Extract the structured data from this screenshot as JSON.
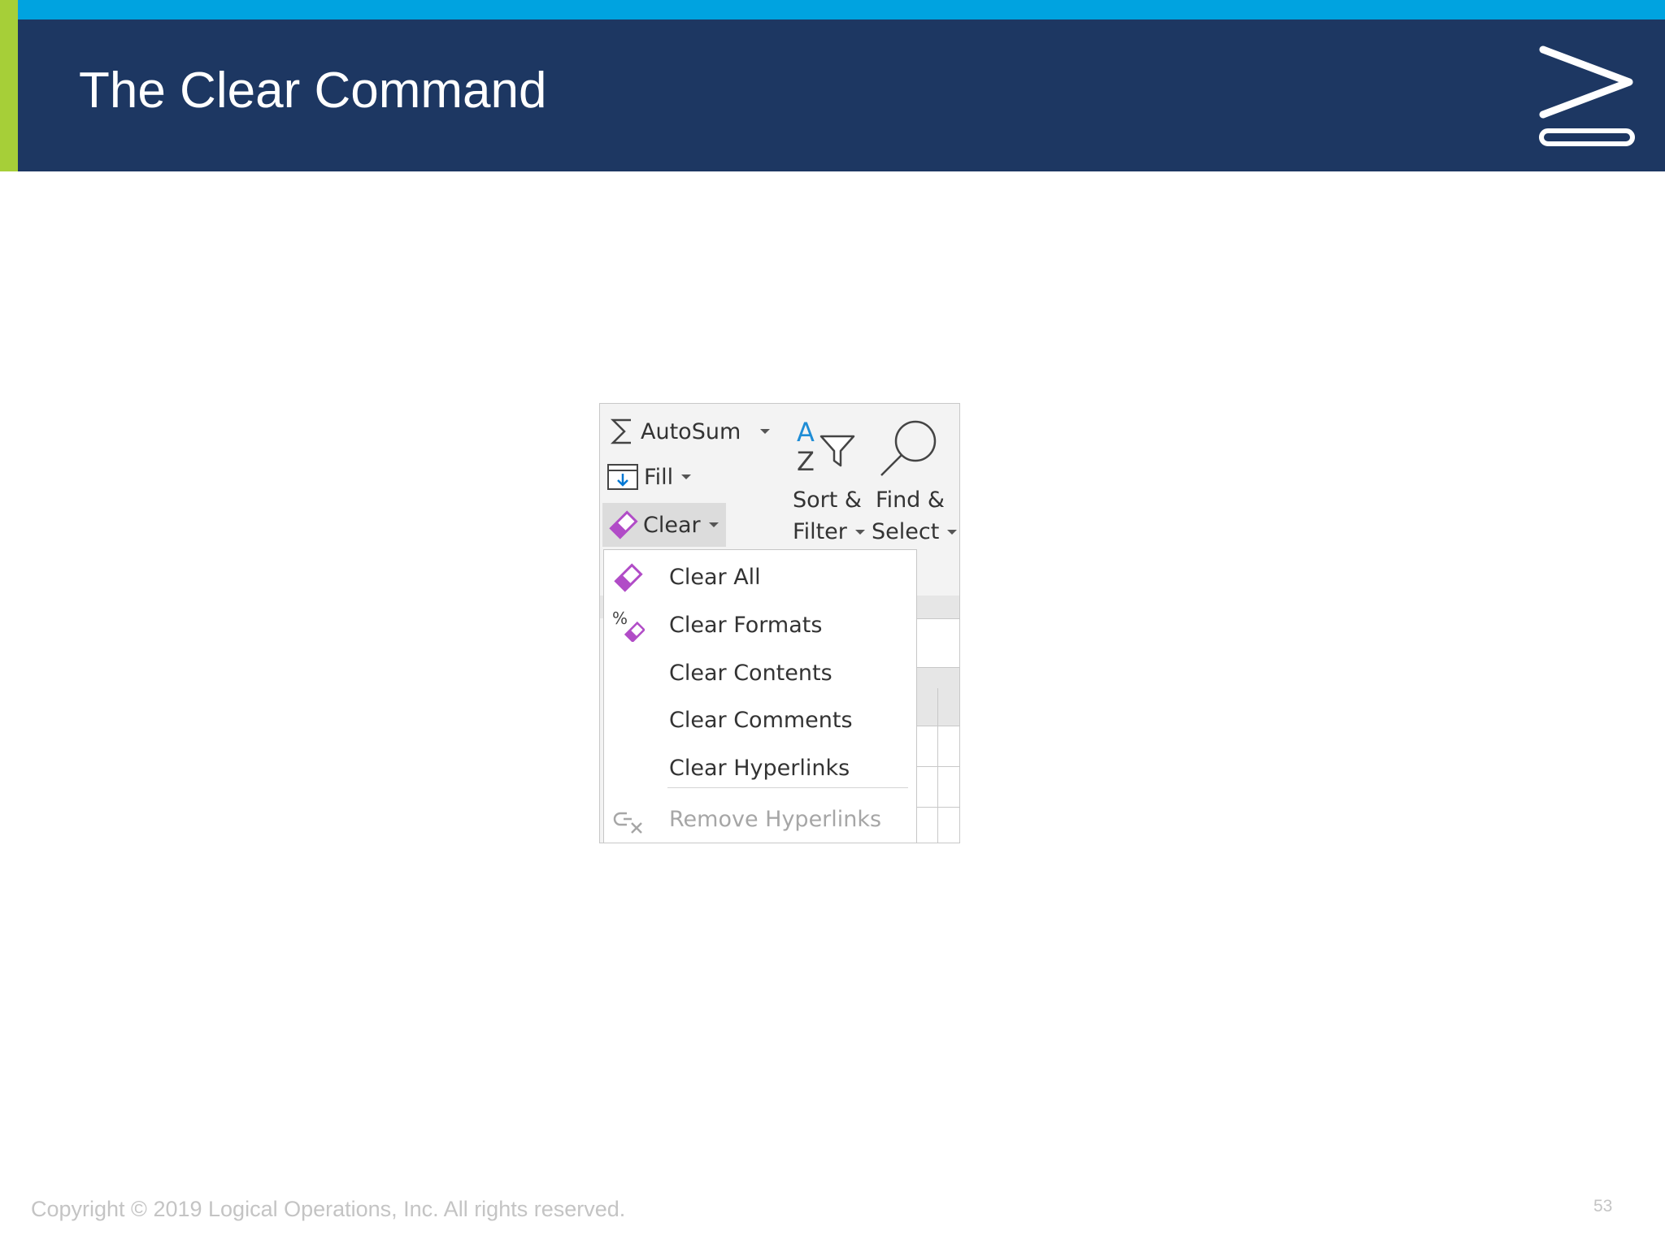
{
  "slide": {
    "title": "The Clear Command",
    "copyright": "Copyright © 2019 Logical Operations, Inc. All rights reserved.",
    "page_number": "53",
    "logo_icon": "chevron-arrow-logo-icon"
  },
  "colors": {
    "top_strip": "#00a3e0",
    "header_bg": "#1d3762",
    "accent_bar": "#a6cf38",
    "clear_icon": "#b14cc7"
  },
  "ribbon": {
    "autosum": {
      "label": "AutoSum",
      "icon": "sigma-icon"
    },
    "fill": {
      "label": "Fill",
      "icon": "fill-down-icon"
    },
    "clear": {
      "label": "Clear",
      "icon": "eraser-icon"
    },
    "sort_filter": {
      "line1": "Sort &",
      "line2": "Filter",
      "icon": "sort-filter-icon"
    },
    "find_select": {
      "line1": "Find &",
      "line2": "Select",
      "icon": "magnifier-icon"
    }
  },
  "menu": {
    "items": [
      {
        "label": "Clear All",
        "icon": "eraser-icon",
        "enabled": true
      },
      {
        "label": "Clear Formats",
        "icon": "clear-formats-icon",
        "enabled": true
      },
      {
        "label": "Clear Contents",
        "icon": "",
        "enabled": true
      },
      {
        "label": "Clear Comments",
        "icon": "",
        "enabled": true
      },
      {
        "label": "Clear Hyperlinks",
        "icon": "",
        "enabled": true
      },
      {
        "label": "Remove Hyperlinks",
        "icon": "remove-hyperlinks-icon",
        "enabled": false
      }
    ]
  }
}
